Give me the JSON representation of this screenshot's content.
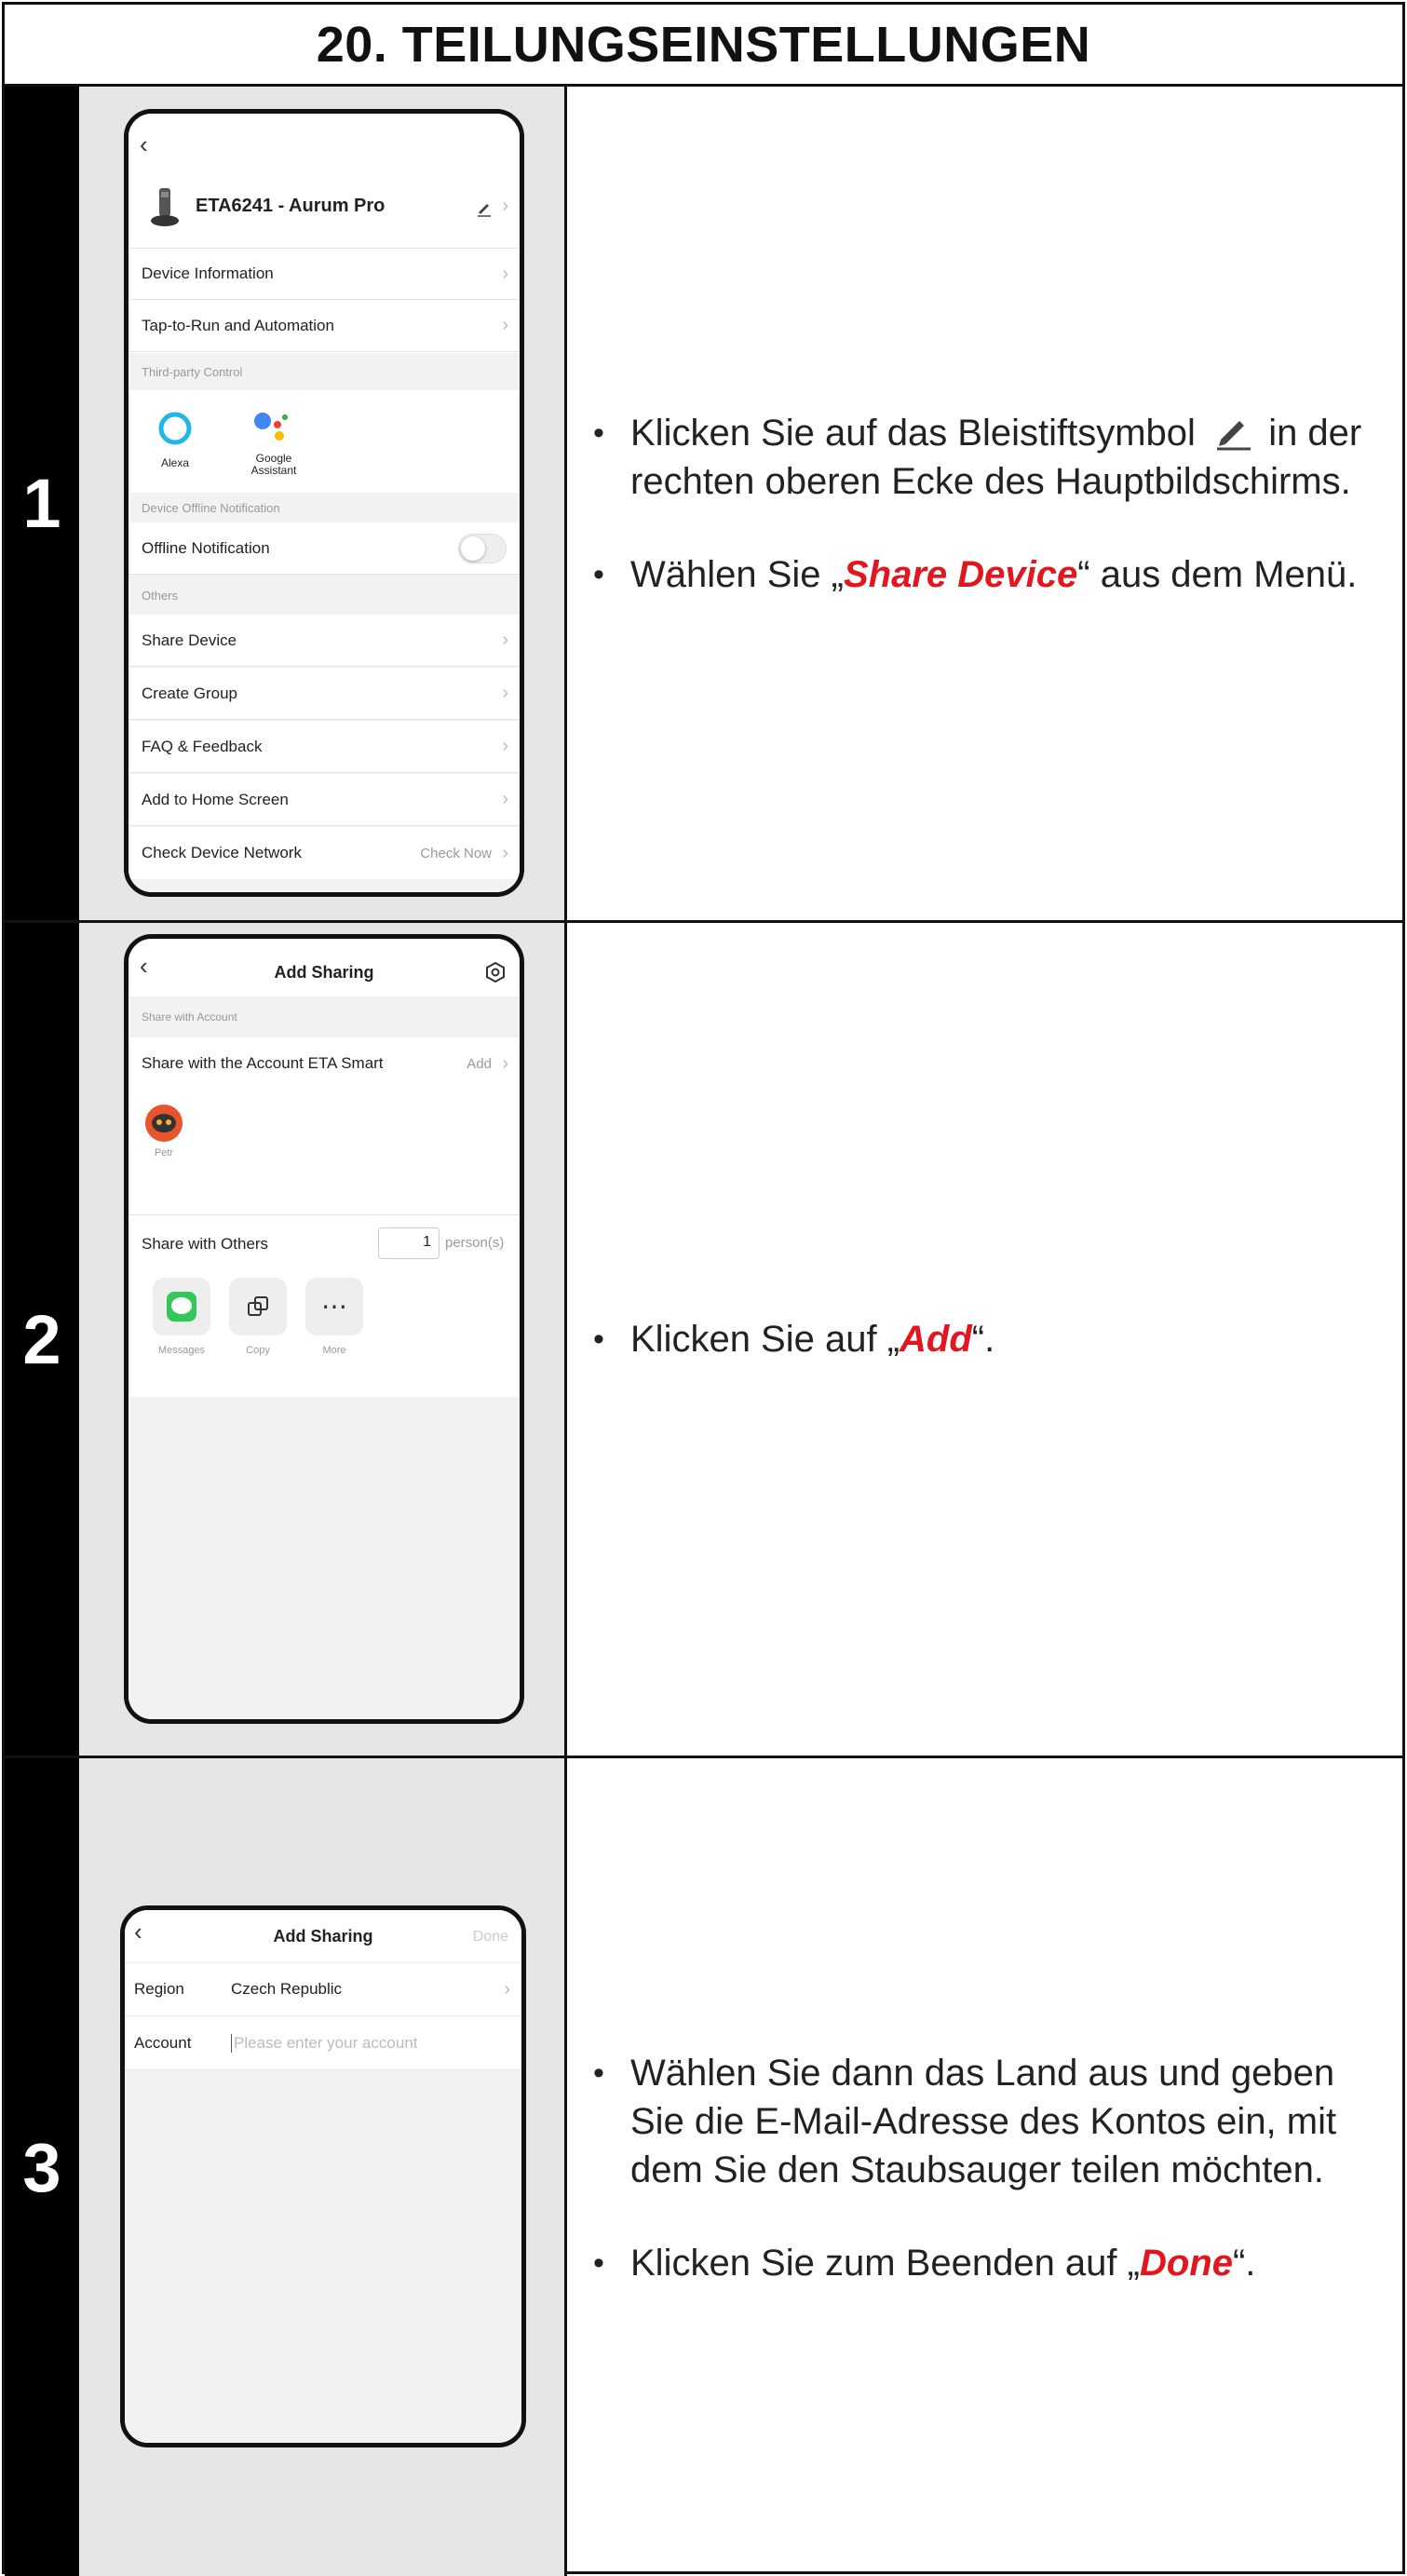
{
  "title": "20. TEILUNGSEINSTELLUNGEN",
  "steps": [
    {
      "number": "1",
      "phone": {
        "device_name": "ETA6241 - Aurum Pro",
        "items": {
          "device_information": "Device Information",
          "tap_to_run": "Tap-to-Run and Automation",
          "offline_notification": "Offline Notification",
          "share_device": "Share Device",
          "create_group": "Create Group",
          "faq": "FAQ & Feedback",
          "add_home": "Add to Home Screen",
          "check_network": "Check Device Network"
        },
        "check_now": "Check Now",
        "sections": {
          "third_party": "Third-party Control",
          "offline": "Device Offline Notification",
          "others": "Others"
        },
        "alexa": "Alexa",
        "google": "Google Assistant"
      },
      "bullets": [
        {
          "pre": "Klicken Sie auf das Bleistiftsymbol",
          "post": "in der rechten oberen Ecke des Hauptbildschirms."
        },
        {
          "pre": "Wählen Sie „",
          "highlight": "Share Device",
          "post": "“ aus dem Menü."
        }
      ]
    },
    {
      "number": "2",
      "phone": {
        "header": "Add Sharing",
        "section_account": "Share with Account",
        "share_account": "Share with the Account ETA Smart",
        "add": "Add",
        "avatar_name": "Petr",
        "share_others": "Share with Others",
        "count_value": "1",
        "count_unit": "person(s)",
        "actions": [
          "Messages",
          "Copy",
          "More"
        ]
      },
      "bullets": [
        {
          "pre": "Klicken Sie auf „",
          "highlight": "Add",
          "post": "“."
        }
      ]
    },
    {
      "number": "3",
      "phone": {
        "header": "Add Sharing",
        "done": "Done",
        "region_label": "Region",
        "region_value": "Czech Republic",
        "account_label": "Account",
        "account_placeholder": "Please enter your account"
      },
      "bullets": [
        {
          "pre": "Wählen Sie dann das Land aus und geben Sie die E-Mail-Adresse des Kontos ein, mit dem Sie den Staubsauger teilen möchten."
        },
        {
          "pre": "Klicken Sie zum Beenden auf „",
          "highlight": "Done",
          "post": "“."
        }
      ]
    }
  ],
  "colors": {
    "highlight": "#e3151e",
    "number_bg": "#000000",
    "image_bg": "#e6e6e6"
  }
}
